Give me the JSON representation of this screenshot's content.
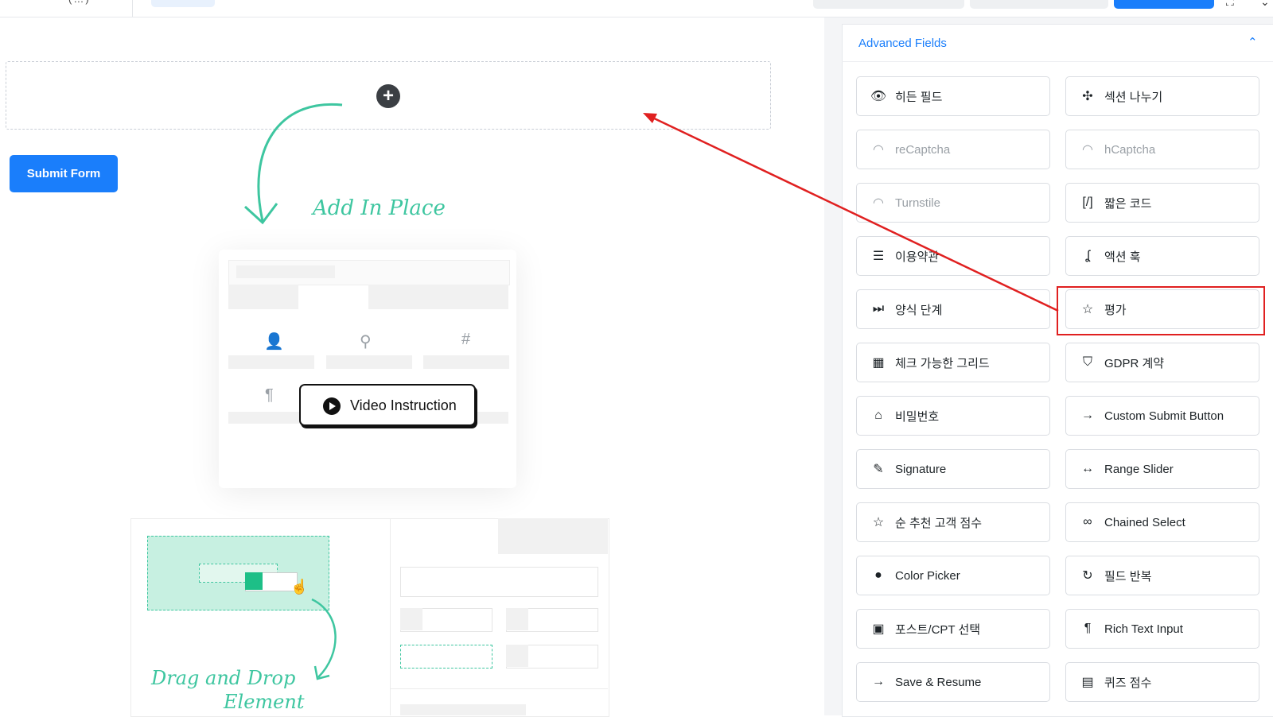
{
  "topbar": {
    "fragment_text": "(…)"
  },
  "canvas": {
    "submit_label": "Submit Form",
    "add_in_place": "Add In Place",
    "video_label": "Video Instruction",
    "drag_drop_line1": "Drag and Drop",
    "drag_drop_line2": "Element"
  },
  "sidebar": {
    "section_title": "Advanced Fields",
    "fields": [
      {
        "label": "히든 필드",
        "icon": "eye-slash-icon",
        "glyph": "👁",
        "disabled": false
      },
      {
        "label": "섹션 나누기",
        "icon": "puzzle-icon",
        "glyph": "✣",
        "disabled": false
      },
      {
        "label": "reCaptcha",
        "icon": "captcha-icon",
        "glyph": "◠",
        "disabled": true
      },
      {
        "label": "hCaptcha",
        "icon": "captcha-icon",
        "glyph": "◠",
        "disabled": true
      },
      {
        "label": "Turnstile",
        "icon": "captcha-icon",
        "glyph": "◠",
        "disabled": true
      },
      {
        "label": "짧은 코드",
        "icon": "shortcode-icon",
        "glyph": "[/]",
        "disabled": false
      },
      {
        "label": "이용약관",
        "icon": "document-icon",
        "glyph": "☰",
        "disabled": false
      },
      {
        "label": "액션 훅",
        "icon": "hook-icon",
        "glyph": "ʆ",
        "disabled": false
      },
      {
        "label": "양식 단계",
        "icon": "steps-icon",
        "glyph": "⏭",
        "disabled": false
      },
      {
        "label": "평가",
        "icon": "star-icon",
        "glyph": "☆",
        "disabled": false
      },
      {
        "label": "체크 가능한 그리드",
        "icon": "grid-check-icon",
        "glyph": "▦",
        "disabled": false
      },
      {
        "label": "GDPR 계약",
        "icon": "shield-icon",
        "glyph": "⛉",
        "disabled": false
      },
      {
        "label": "비밀번호",
        "icon": "lock-icon",
        "glyph": "⌂",
        "disabled": false
      },
      {
        "label": "Custom Submit Button",
        "icon": "arrow-right-icon",
        "glyph": "→",
        "disabled": false
      },
      {
        "label": "Signature",
        "icon": "pen-icon",
        "glyph": "✎",
        "disabled": false
      },
      {
        "label": "Range Slider",
        "icon": "range-icon",
        "glyph": "↔",
        "disabled": false
      },
      {
        "label": "순 추천 고객 점수",
        "icon": "star-icon",
        "glyph": "☆",
        "disabled": false
      },
      {
        "label": "Chained Select",
        "icon": "link-icon",
        "glyph": "∞",
        "disabled": false
      },
      {
        "label": "Color Picker",
        "icon": "drop-icon",
        "glyph": "●",
        "disabled": false
      },
      {
        "label": "필드 반복",
        "icon": "repeat-icon",
        "glyph": "↻",
        "disabled": false
      },
      {
        "label": "포스트/CPT 선택",
        "icon": "post-icon",
        "glyph": "▣",
        "disabled": false
      },
      {
        "label": "Rich Text Input",
        "icon": "paragraph-icon",
        "glyph": "¶",
        "disabled": false
      },
      {
        "label": "Save & Resume",
        "icon": "arrow-right-icon",
        "glyph": "→",
        "disabled": false
      },
      {
        "label": "퀴즈 점수",
        "icon": "quiz-icon",
        "glyph": "▤",
        "disabled": false
      }
    ]
  },
  "colors": {
    "accent": "#1a7efb",
    "annotation_red": "#e02020",
    "illustration_green": "#3ec6a0"
  }
}
